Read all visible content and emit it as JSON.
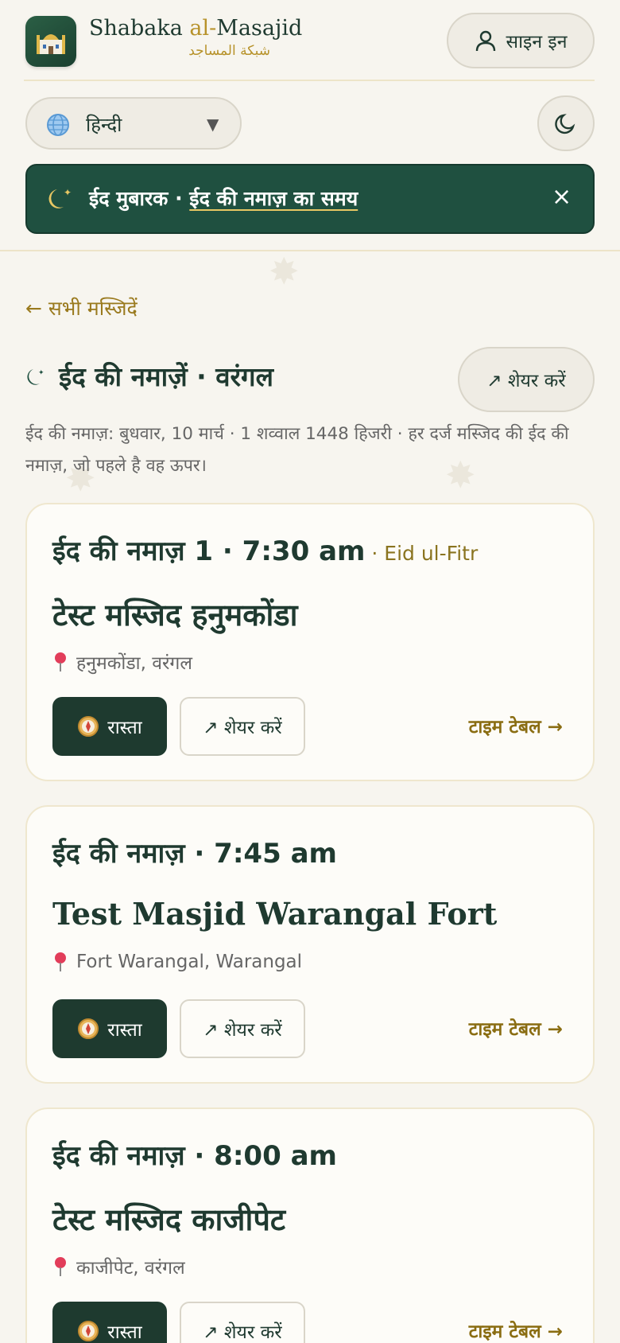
{
  "header": {
    "brand_en_part1": "Shabaka ",
    "brand_en_part2": "al-",
    "brand_en_part3": "Masajid",
    "brand_ar": "شبكة المساجد",
    "signin_label": "साइन इन"
  },
  "language": {
    "selected": "हिन्दी"
  },
  "banner": {
    "text": "ईद मुबारक · ",
    "link": "ईद की नमाज़ का समय",
    "close": "×"
  },
  "nav": {
    "back_label": "← सभी मस्जिदें"
  },
  "page": {
    "title": "ईद की नमाज़ें ·  वरंगल",
    "share_label": "↗ शेयर करें",
    "subtitle": "ईद की नमाज़: बुधवार, 10 मार्च · 1 शव्वाल 1448 हिजरी · हर दर्ज मस्जिद की ईद की नमाज़, जो पहले है वह ऊपर।"
  },
  "cards": [
    {
      "time": "ईद की नमाज़ 1 · 7:30 am",
      "occasion": " · Eid ul-Fitr",
      "mosque": "टेस्ट मस्जिद हनुमकोंडा",
      "location": "हनुमकोंडा, वरंगल",
      "directions": "रास्ता",
      "share": "↗ शेयर करें",
      "timetable": "टाइम टेबल →"
    },
    {
      "time": "ईद की नमाज़ · 7:45 am",
      "occasion": "",
      "mosque": "Test Masjid Warangal Fort",
      "location": "Fort Warangal, Warangal",
      "directions": "रास्ता",
      "share": "↗ शेयर करें",
      "timetable": "टाइम टेबल →"
    },
    {
      "time": "ईद की नमाज़ · 8:00 am",
      "occasion": "",
      "mosque": "टेस्ट मस्जिद काजीपेट",
      "location": "काजीपेट, वरंगल",
      "directions": "रास्ता",
      "share": "↗ शेयर करें",
      "timetable": "टाइम टेबल →"
    }
  ],
  "colors": {
    "background": "#f7f5ef",
    "primary_green": "#1f5040",
    "gold_accent": "#b7922a"
  },
  "icons": [
    "mosque-logo-icon",
    "user-icon",
    "globe-icon",
    "moon-icon",
    "crescent-icon",
    "pin-icon",
    "compass-icon"
  ]
}
